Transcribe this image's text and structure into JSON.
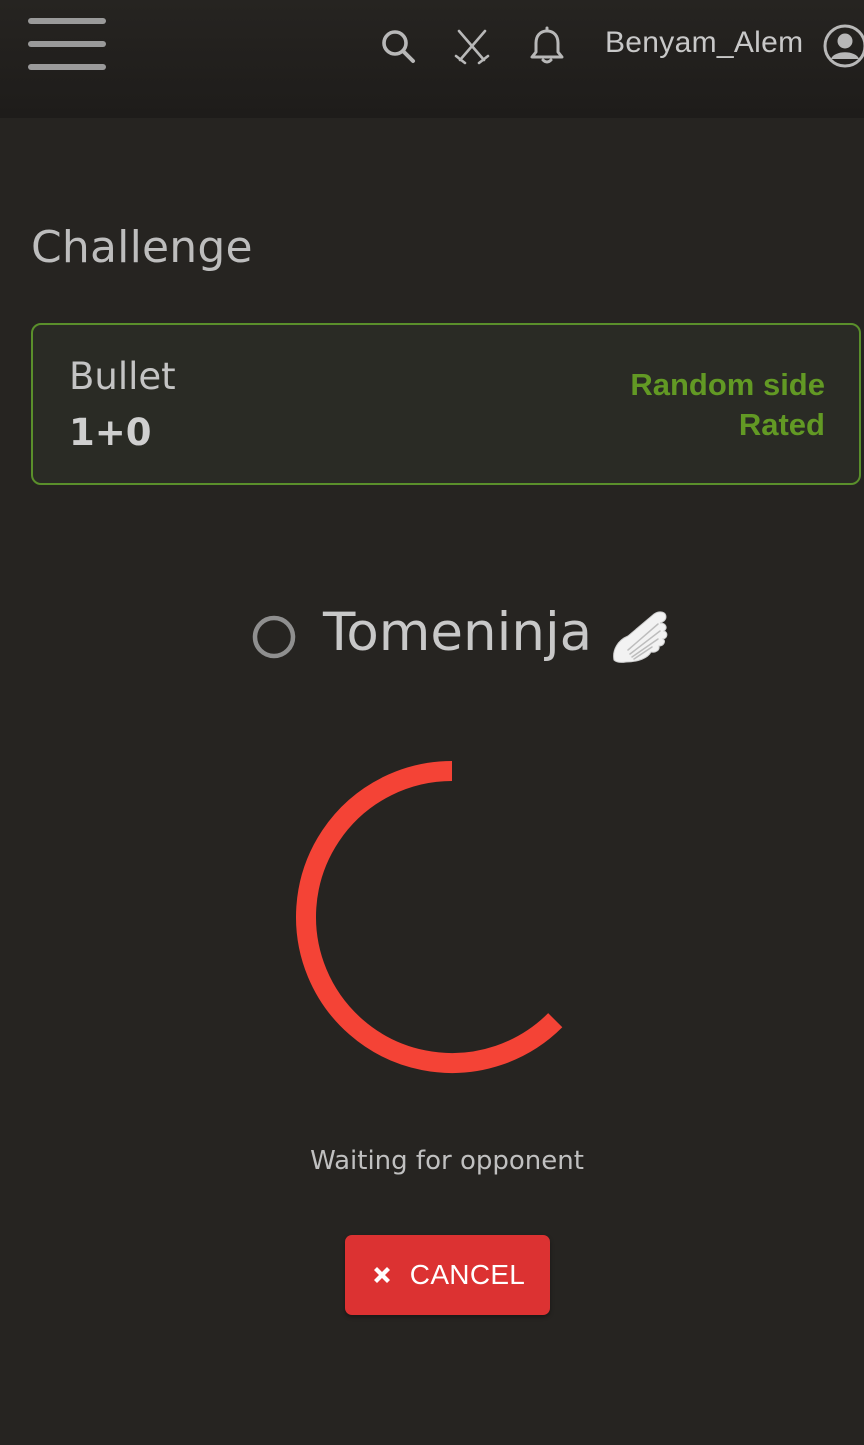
{
  "header": {
    "menu_icon": "hamburger-menu-icon",
    "search_icon": "search-icon",
    "tools_icon": "crossed-swords-icon",
    "notifications_icon": "bell-icon",
    "username": "Benyam_Alem",
    "avatar_icon": "user-circle-icon"
  },
  "page": {
    "title": "Challenge"
  },
  "challenge": {
    "speed": "Bullet",
    "clock": "1+0",
    "color": "Random side",
    "mode": "Rated",
    "accent_color": "#629924"
  },
  "opponent": {
    "status_icon": "offline-circle-icon",
    "name": "Tomeninja",
    "badge_icon": "wing-icon"
  },
  "waiting": {
    "spinner_color": "#f44336",
    "message": "Waiting for opponent"
  },
  "actions": {
    "cancel_label": "CANCEL",
    "cancel_icon": "close-x-icon",
    "cancel_color": "#dc3232"
  }
}
